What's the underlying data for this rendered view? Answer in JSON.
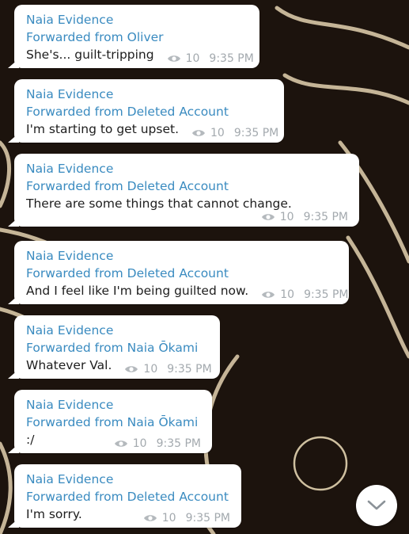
{
  "messages": [
    {
      "sender": "Naia Evidence",
      "forwarded": "Forwarded from Oliver",
      "text": "She's... guilt-tripping",
      "views": "10",
      "time": "9:35 PM"
    },
    {
      "sender": "Naia Evidence",
      "forwarded": "Forwarded from Deleted Account",
      "text": "I'm starting to get upset.",
      "views": "10",
      "time": "9:35 PM"
    },
    {
      "sender": "Naia Evidence",
      "forwarded": "Forwarded from Deleted Account",
      "text": "There are some things that cannot change.",
      "views": "10",
      "time": "9:35 PM"
    },
    {
      "sender": "Naia Evidence",
      "forwarded": "Forwarded from Deleted Account",
      "text": "And I feel like I'm being guilted now.",
      "views": "10",
      "time": "9:35 PM"
    },
    {
      "sender": "Naia Evidence",
      "forwarded": "Forwarded from Naia Ōkami",
      "text": "Whatever Val.",
      "views": "10",
      "time": "9:35 PM"
    },
    {
      "sender": "Naia Evidence",
      "forwarded": "Forwarded from Naia Ōkami",
      "text": ":/",
      "views": "10",
      "time": "9:35 PM"
    },
    {
      "sender": "Naia Evidence",
      "forwarded": "Forwarded from Deleted Account",
      "text": "I'm sorry.",
      "views": "10",
      "time": "9:35 PM"
    }
  ],
  "icons": {
    "views": "eye-icon",
    "scroll_down": "chevron-down-icon"
  },
  "colors": {
    "sender_name": "#3a8bc0",
    "meta_text": "#a3a9ae",
    "bubble": "#ffffff",
    "message_text": "#1d1d1d"
  }
}
